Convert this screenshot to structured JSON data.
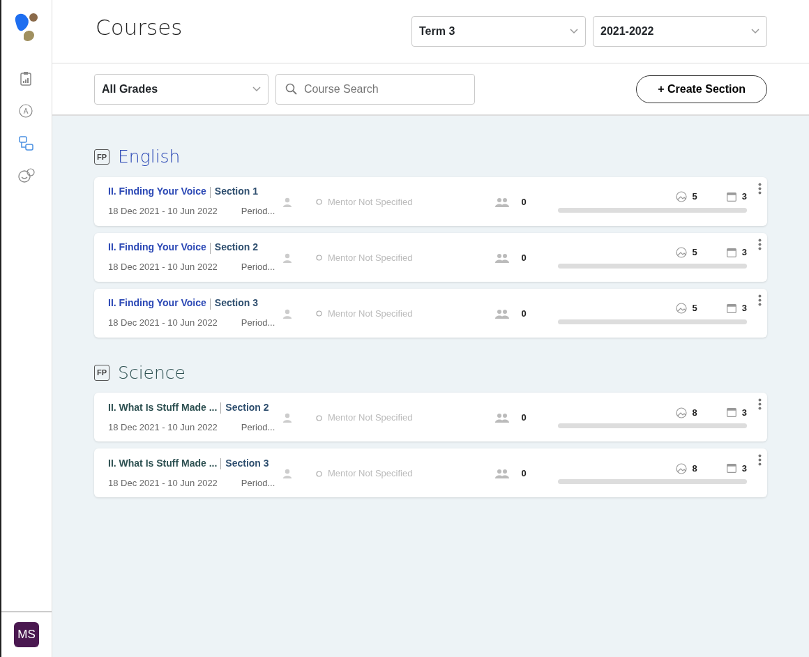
{
  "sidebar": {
    "items": [
      {
        "kind": "report",
        "selected": false
      },
      {
        "kind": "grade",
        "glyph": "A",
        "selected": false
      },
      {
        "kind": "sections",
        "selected": true
      },
      {
        "kind": "faces",
        "selected": false
      }
    ],
    "user": {
      "initials": "MS"
    }
  },
  "header": {
    "title": "Courses",
    "term": "Term 3",
    "year": "2021-2022"
  },
  "filters": {
    "grade": "All Grades",
    "search": {
      "placeholder": "Course Search"
    },
    "create_button": "+ Create Section"
  },
  "subjects": [
    {
      "badge": "FP",
      "name": "English",
      "color": "#2b48b5",
      "courses": [
        {
          "title": "II. Finding Your Voice",
          "section": "Section 1",
          "dates": "18 Dec 2021 - 10 Jun 2022",
          "period": "Period...",
          "mentor": "Mentor Not Specified",
          "students": "0",
          "lessons": "5",
          "units": "3",
          "level": 0
        },
        {
          "title": "II. Finding Your Voice",
          "section": "Section 2",
          "dates": "18 Dec 2021 - 10 Jun 2022",
          "period": "Period...",
          "mentor": "Mentor Not Specified",
          "students": "0",
          "lessons": "5",
          "units": "3",
          "level": 0
        },
        {
          "title": "II. Finding Your Voice",
          "section": "Section 3",
          "dates": "18 Dec 2021 - 10 Jun 2022",
          "period": "Period...",
          "mentor": "Mentor Not Specified",
          "students": "0",
          "lessons": "5",
          "units": "3",
          "level": 0
        }
      ]
    },
    {
      "badge": "FP",
      "name": "Science",
      "color": "#2e5152",
      "courses": [
        {
          "title": "II. What Is Stuff Made ...",
          "section": "Section 2",
          "dates": "18 Dec 2021 - 10 Jun 2022",
          "period": "Period...",
          "mentor": "Mentor Not Specified",
          "students": "0",
          "lessons": "8",
          "units": "3",
          "level": 0
        },
        {
          "title": "II. What Is Stuff Made ...",
          "section": "Section 3",
          "dates": "18 Dec 2021 - 10 Jun 2022",
          "period": "Period...",
          "mentor": "Mentor Not Specified",
          "students": "0",
          "lessons": "8",
          "units": "3",
          "level": 0
        }
      ]
    }
  ]
}
